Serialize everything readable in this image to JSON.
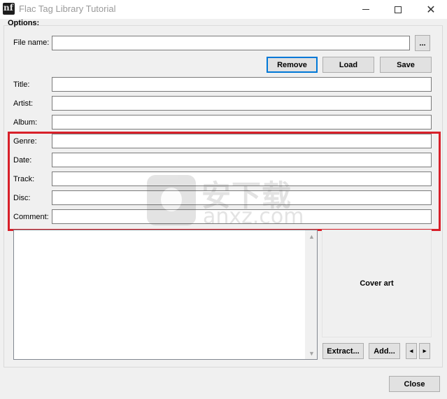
{
  "window": {
    "title": "Flac Tag Library Tutorial",
    "icon": "flac-app-icon",
    "controls": {
      "minimize": "minimize-icon",
      "maximize": "maximize-icon",
      "close": "✕"
    }
  },
  "options": {
    "label": "Options:",
    "file_name_label": "File name:",
    "file_name_value": "",
    "browse_label": "...",
    "buttons": {
      "remove": "Remove",
      "load": "Load",
      "save": "Save"
    },
    "fields": [
      {
        "label": "Title:",
        "value": ""
      },
      {
        "label": "Artist:",
        "value": ""
      },
      {
        "label": "Album:",
        "value": ""
      },
      {
        "label": "Genre:",
        "value": ""
      },
      {
        "label": "Date:",
        "value": ""
      },
      {
        "label": "Track:",
        "value": ""
      },
      {
        "label": "Disc:",
        "value": ""
      },
      {
        "label": "Comment:",
        "value": ""
      }
    ],
    "highlight_color": "#d8202a"
  },
  "cover": {
    "label": "Cover art",
    "extract_label": "Extract...",
    "add_label": "Add...",
    "prev_glyph": "◂",
    "next_glyph": "▸"
  },
  "footer": {
    "close_label": "Close"
  },
  "watermark": {
    "text": "安下载",
    "sub": "anxz.com"
  }
}
